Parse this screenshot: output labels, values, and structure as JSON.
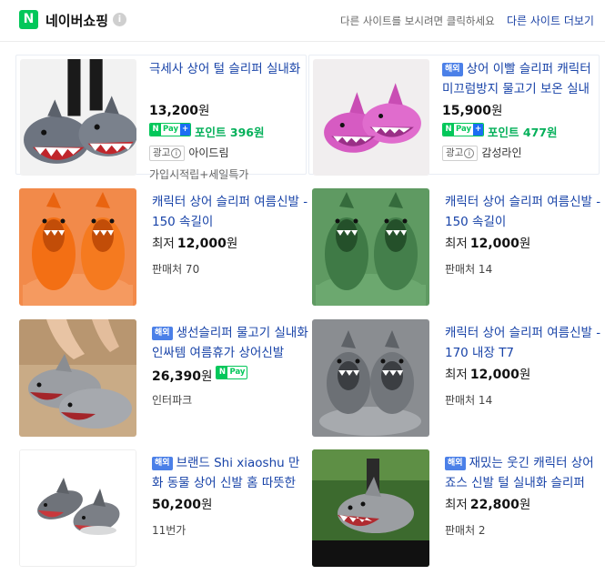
{
  "header": {
    "logo_letter": "N",
    "brand": "네이버쇼핑",
    "info_glyph": "i",
    "hint": "다른 사이트를 보시려면 클릭하세요",
    "more_link": "다른 사이트 더보기"
  },
  "labels": {
    "abroad": "해외",
    "ad": "광고",
    "ad_info": "i",
    "pay_n": "N",
    "pay_text": "Pay",
    "pay_plus": "+"
  },
  "products": [
    {
      "title": "극세사 상어 털 슬리퍼 실내화",
      "price": "13,200",
      "unit": "원",
      "point": "포인트 396원",
      "store": "아이드림",
      "sub": "가입시적립+세일특가"
    },
    {
      "title": "상어 이빨 슬리퍼 캐릭터 미끄럼방지 물고기 보온 실내화",
      "price": "15,900",
      "unit": "원",
      "point": "포인트 477원",
      "store": "감성라인"
    },
    {
      "title": "캐릭터 상어 슬리퍼 여름신발 - 150 속길이",
      "price_prefix": "최저",
      "price": "12,000",
      "unit": "원",
      "seller": "판매처 70"
    },
    {
      "title": "캐릭터 상어 슬리퍼 여름신발 - 150 속길이",
      "price_prefix": "최저",
      "price": "12,000",
      "unit": "원",
      "seller": "판매처 14"
    },
    {
      "title": "생선슬리퍼 물고기 실내화 인싸템 여름휴가 상어신발",
      "price": "26,390",
      "unit": "원",
      "seller": "인터파크"
    },
    {
      "title": "캐릭터 상어 슬리퍼 여름신발 - 170 내장 T7",
      "price_prefix": "최저",
      "price": "12,000",
      "unit": "원",
      "seller": "판매처 14"
    },
    {
      "title": "브랜드 Shi xiaoshu 만화 동물 상어 신발 홈 따뜻한 슬리퍼",
      "price": "50,200",
      "unit": "원",
      "seller": "11번가"
    },
    {
      "title": "재밌는 웃긴 캐릭터 상어 죠스 신발 털 실내화 슬리퍼",
      "price_prefix": "최저",
      "price": "22,800",
      "unit": "원",
      "seller": "판매처 2"
    }
  ],
  "icons": {
    "brand_logo": "naver-n-logo-icon",
    "info": "info-circle-icon",
    "pay": "naver-pay-badge-icon",
    "ad_info": "info-circle-icon"
  },
  "colors": {
    "brand_green": "#03c75a",
    "link_blue": "#1843a8",
    "point_green": "#05b05a",
    "abroad_badge": "#4b80e8"
  }
}
